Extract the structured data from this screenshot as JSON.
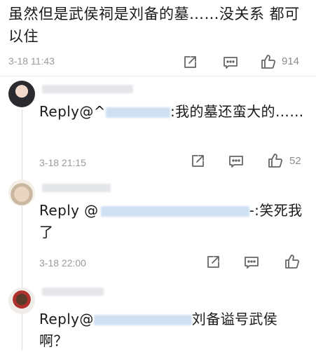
{
  "main_comment": {
    "text": "虽然但是武侯祠是刘备的墓……没关系 都可以住",
    "time": "3-18 11:43",
    "likes": "914"
  },
  "replies": [
    {
      "prefix": "Reply@^",
      "body": ":我的墓还蛮大的……",
      "time": "3-18 21:15",
      "likes": "52"
    },
    {
      "prefix": "Reply @",
      "body": "-:笑死我了",
      "time": "3-18 22:00",
      "likes": ""
    },
    {
      "prefix": "Reply@",
      "body": "刘备谥号武侯啊？",
      "time": "",
      "likes": ""
    }
  ],
  "icons": [
    "share-icon",
    "comment-icon",
    "like-icon"
  ],
  "colors": {
    "text": "#1a1a1a",
    "meta": "#9b9b9b",
    "divider": "#ececec",
    "icon": "#666666"
  }
}
